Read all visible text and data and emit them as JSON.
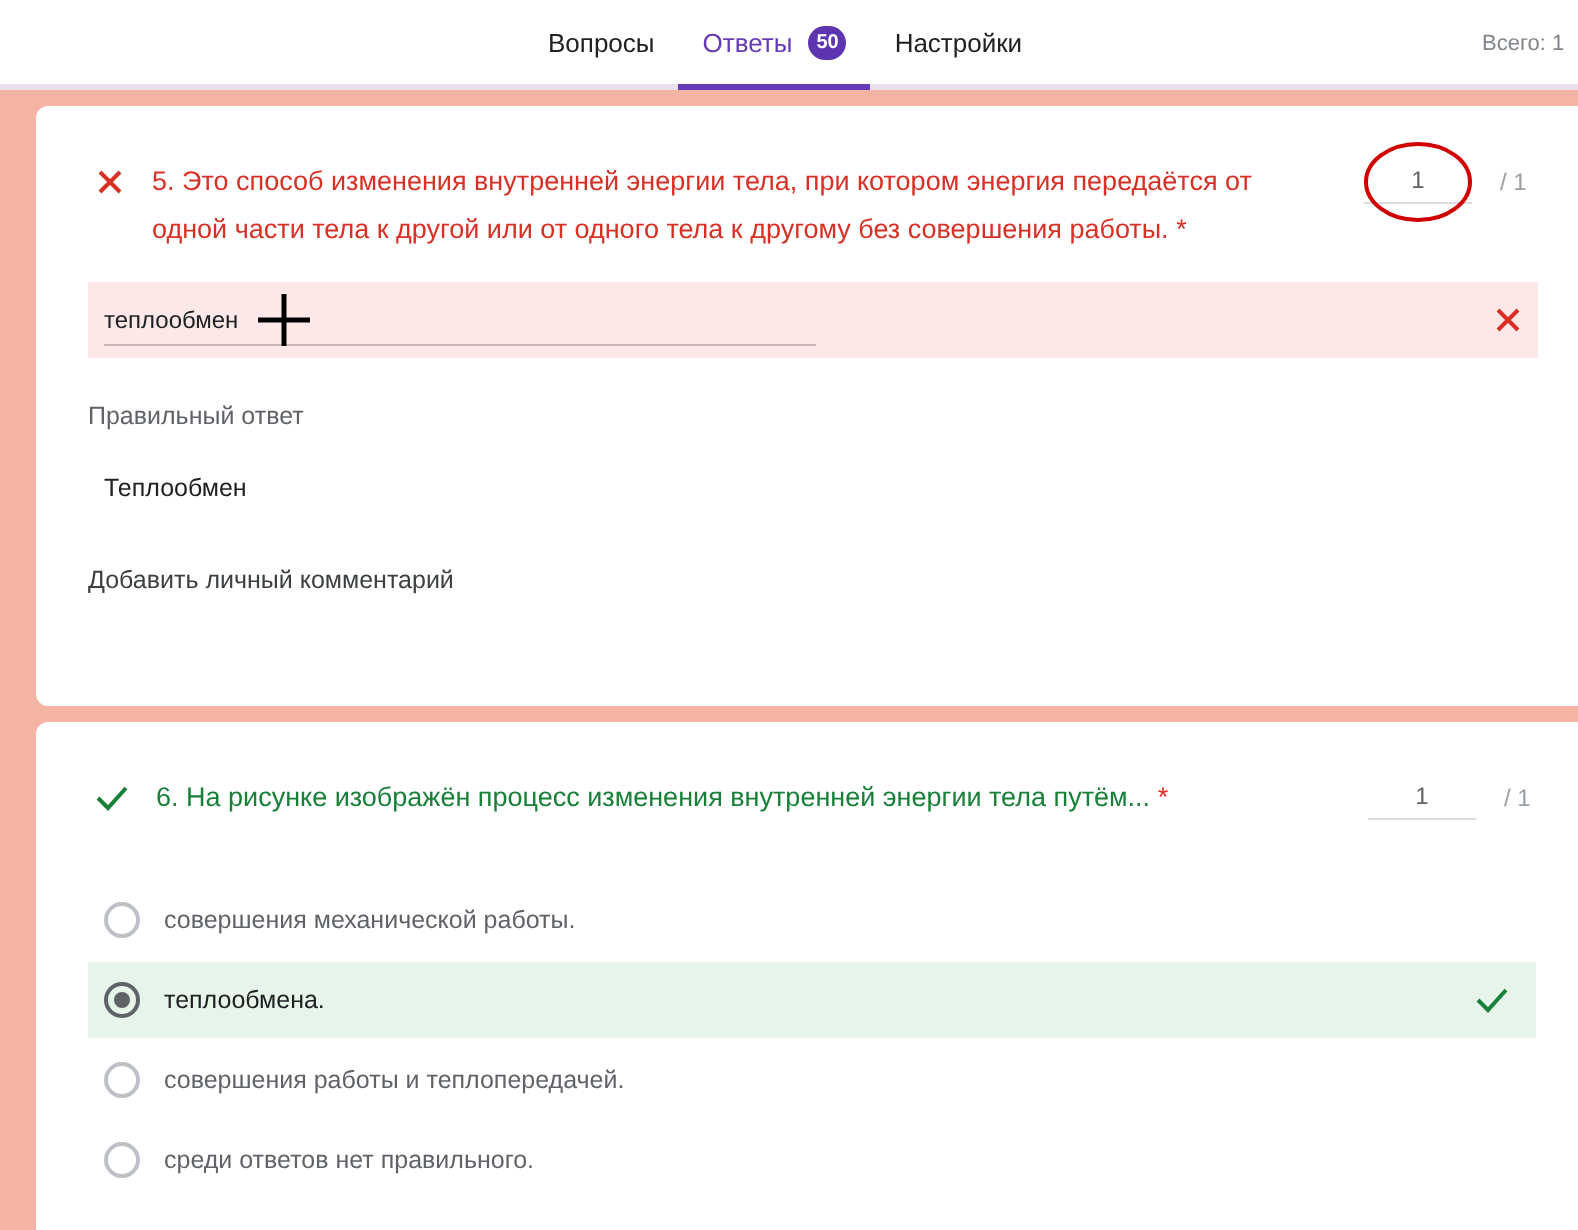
{
  "tabs": [
    {
      "label": "Вопросы",
      "selected": false
    },
    {
      "label": "Ответы",
      "selected": true,
      "badge": "50"
    },
    {
      "label": "Настройки",
      "selected": false
    }
  ],
  "total": "Всего: 1",
  "questions": [
    {
      "kind": "text",
      "correct": false,
      "title": "5. Это способ изменения внутренней энергии тела, при котором энергия передаётся от одной части тела к другой или от одного тела к другому без совершения работы.",
      "required": "*",
      "score": "1",
      "score_circled": true,
      "max": "/ 1",
      "answer": "теплообмен",
      "correct_label": "Правильный ответ",
      "correct_answer": "Теплообмен",
      "comment": "Добавить личный комментарий"
    },
    {
      "kind": "choice",
      "correct": true,
      "title": "6. На рисунке изображён процесс изменения внутренней энергии тела путём...",
      "required": "*",
      "score": "1",
      "score_circled": false,
      "max": "/ 1",
      "options": [
        {
          "label": "совершения механической работы.",
          "selected": false
        },
        {
          "label": "теплообмена.",
          "selected": true
        },
        {
          "label": "совершения работы и теплопередачей.",
          "selected": false
        },
        {
          "label": "среди ответов нет правильного.",
          "selected": false
        }
      ]
    }
  ]
}
